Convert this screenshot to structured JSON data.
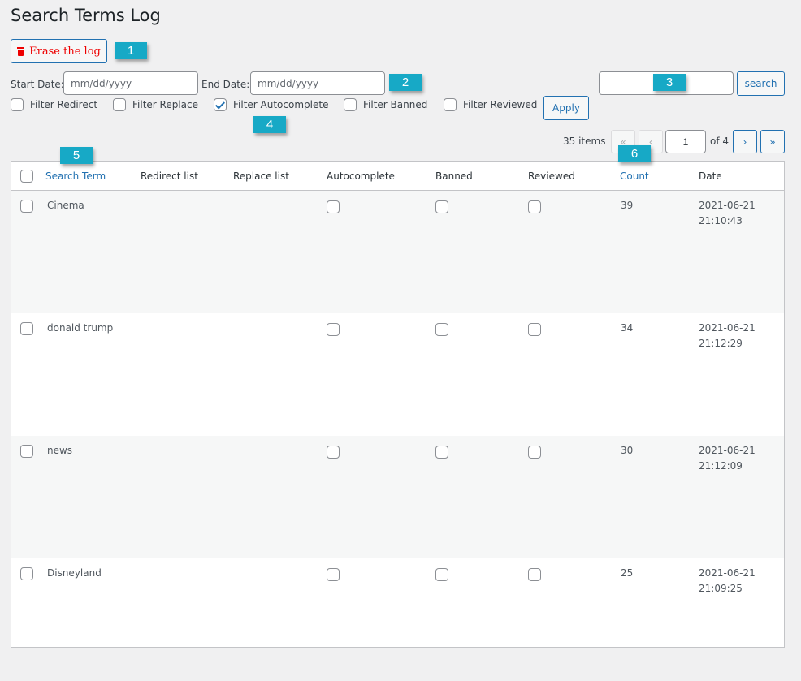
{
  "page": {
    "title": "Search Terms Log"
  },
  "toolbar": {
    "erase_label": "Erase the log",
    "start_date_label": "Start Date:",
    "start_date_placeholder": "mm/dd/yyyy",
    "start_date_value": "",
    "end_date_label": "End Date:",
    "end_date_placeholder": "mm/dd/yyyy",
    "end_date_value": "",
    "search_value": "",
    "search_label": "search",
    "apply_label": "Apply"
  },
  "filters": [
    {
      "label": "Filter Redirect",
      "checked": false
    },
    {
      "label": "Filter Replace",
      "checked": false
    },
    {
      "label": "Filter Autocomplete",
      "checked": true
    },
    {
      "label": "Filter Banned",
      "checked": false
    },
    {
      "label": "Filter Reviewed",
      "checked": false
    }
  ],
  "annotations": [
    "1",
    "2",
    "3",
    "4",
    "5",
    "6"
  ],
  "pagination": {
    "items_count": "35 items",
    "first": "«",
    "prev": "‹",
    "current_page": "1",
    "of_total": "of 4",
    "next": "›",
    "last": "»"
  },
  "table": {
    "columns": [
      "Search Term",
      "Redirect list",
      "Replace list",
      "Autocomplete",
      "Banned",
      "Reviewed",
      "Count",
      "Date"
    ],
    "rows": [
      {
        "term": "Cinema",
        "redirect": "",
        "replace": "",
        "autocomplete": false,
        "banned": false,
        "reviewed": false,
        "count": "39",
        "date": "2021-06-21",
        "time": "21:10:43"
      },
      {
        "term": "donald trump",
        "redirect": "",
        "replace": "",
        "autocomplete": false,
        "banned": false,
        "reviewed": false,
        "count": "34",
        "date": "2021-06-21",
        "time": "21:12:29"
      },
      {
        "term": "news",
        "redirect": "",
        "replace": "",
        "autocomplete": false,
        "banned": false,
        "reviewed": false,
        "count": "30",
        "date": "2021-06-21",
        "time": "21:12:09"
      },
      {
        "term": "Disneyland",
        "redirect": "",
        "replace": "",
        "autocomplete": false,
        "banned": false,
        "reviewed": false,
        "count": "25",
        "date": "2021-06-21",
        "time": "21:09:25"
      }
    ]
  }
}
